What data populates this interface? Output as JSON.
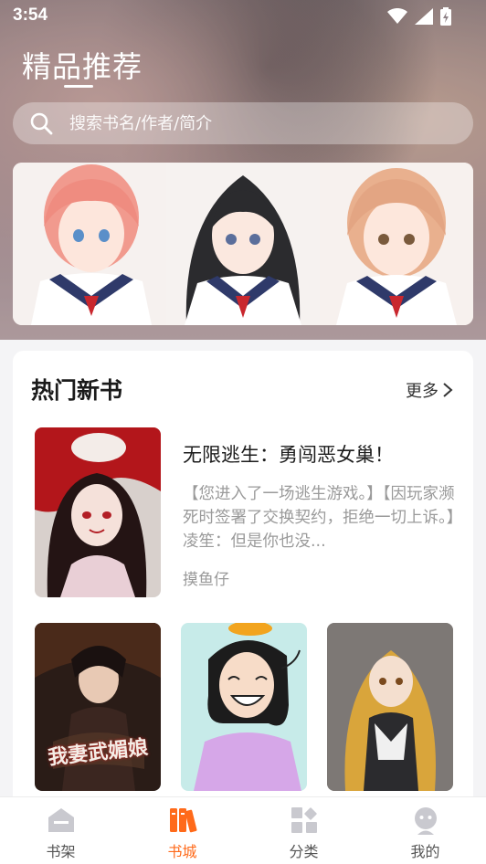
{
  "status_bar": {
    "time": "3:54"
  },
  "header": {
    "title": "精品推荐"
  },
  "search": {
    "placeholder": "搜索书名/作者/简介"
  },
  "hot_section": {
    "title": "热门新书",
    "more_label": "更多",
    "featured": {
      "title": "无限逃生：勇闯恶女巢！",
      "description": "【您进入了一场逃生游戏。】【因玩家濒死时签署了交换契约，拒绝一切上诉。】凌笙：但是你也没...",
      "author": "摸鱼仔"
    },
    "grid_cover_text": "我妻武媚娘"
  },
  "tabs": [
    {
      "label": "书架",
      "icon": "bookshelf-icon"
    },
    {
      "label": "书城",
      "icon": "bookstore-icon"
    },
    {
      "label": "分类",
      "icon": "category-icon"
    },
    {
      "label": "我的",
      "icon": "profile-icon"
    }
  ],
  "colors": {
    "accent": "#ff6a1a",
    "inactive": "#c9c9cf"
  }
}
